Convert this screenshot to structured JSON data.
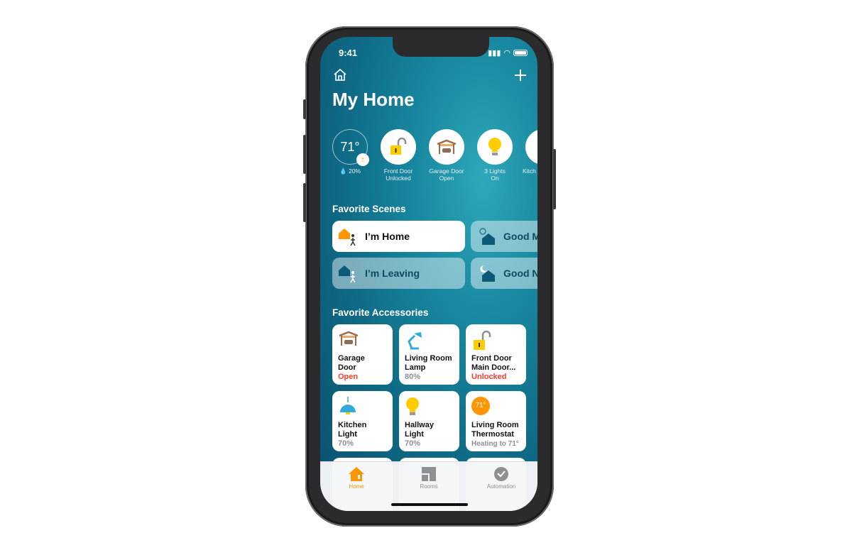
{
  "status_bar": {
    "time": "9:41"
  },
  "header": {
    "title": "My Home",
    "home_icon": "house-icon",
    "add_icon": "plus-icon"
  },
  "status_items": [
    {
      "value": "71°",
      "sub": "20%",
      "icon": "thermostat-icon"
    },
    {
      "line1": "Front Door",
      "line2": "Unlocked",
      "icon": "lock-open-icon"
    },
    {
      "line1": "Garage Door",
      "line2": "Open",
      "icon": "garage-icon"
    },
    {
      "line1": "3 Lights",
      "line2": "On",
      "icon": "lightbulb-icon"
    },
    {
      "line1": "Kitch",
      "line2": "",
      "icon": "light-icon"
    }
  ],
  "scenes": {
    "heading": "Favorite Scenes",
    "items": [
      {
        "label": "I’m Home",
        "active": true
      },
      {
        "label": "Good M",
        "active": false
      },
      {
        "label": "I’m Leaving",
        "active": false
      },
      {
        "label": "Good N",
        "active": false
      }
    ]
  },
  "accessories": {
    "heading": "Favorite Accessories",
    "items": [
      {
        "name1": "Garage",
        "name2": "Door",
        "status": "Open",
        "alert": true
      },
      {
        "name1": "Living Room",
        "name2": "Lamp",
        "status": "80%",
        "alert": false
      },
      {
        "name1": "Front Door",
        "name2": "Main Door...",
        "status": "Unlocked",
        "alert": true
      },
      {
        "name1": "Kitchen",
        "name2": "Light",
        "status": "70%",
        "alert": false
      },
      {
        "name1": "Hallway",
        "name2": "Light",
        "status": "70%",
        "alert": false
      },
      {
        "name1": "Living Room",
        "name2": "Thermostat",
        "status": "Heating to 71°",
        "alert": false,
        "badge": "71°"
      }
    ]
  },
  "tabs": [
    {
      "label": "Home",
      "active": true
    },
    {
      "label": "Rooms",
      "active": false
    },
    {
      "label": "Automation",
      "active": false
    }
  ],
  "colors": {
    "accent": "#ff9500",
    "alert": "#ff3b30",
    "yellow": "#ffcc00",
    "blue": "#34aadc"
  }
}
